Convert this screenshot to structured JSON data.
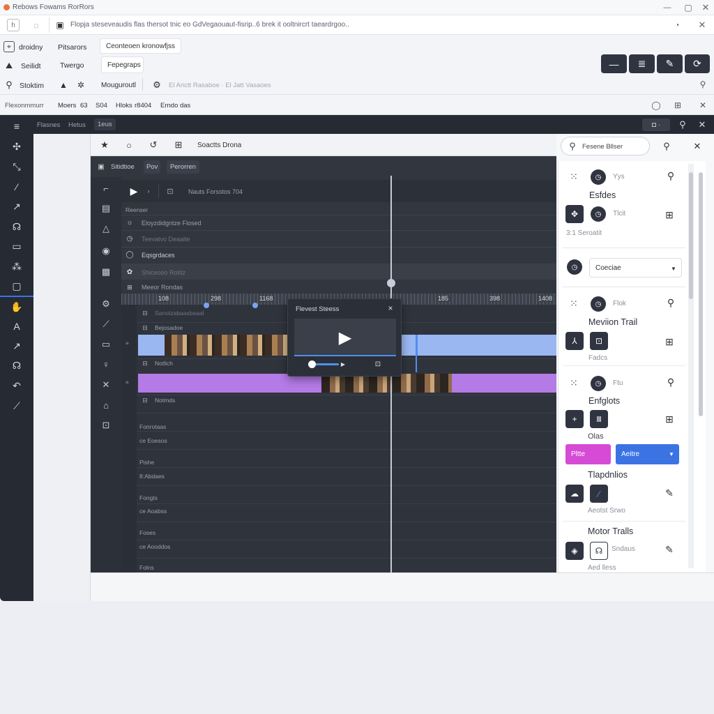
{
  "window": {
    "title": "Rebows Fowams RorRors",
    "address": "Flopja steseveaudis flas thersot tnic eo GdVegaouaut-fisrip..6 brek it ooltnircrt taeardrgoo..."
  },
  "ribbon": {
    "left_items": [
      {
        "icon": "map-pin-icon",
        "label": "droidny"
      },
      {
        "icon": "mountain-icon",
        "label": "Seilidt"
      },
      {
        "icon": "search-icon",
        "label": "Stoktim"
      }
    ],
    "col2": [
      "Pitsarors",
      "Twergo"
    ],
    "pill1": "Ceonteoen kronowfjss",
    "pill2": "Fepegraps",
    "row3_label": "Mouguroutl",
    "row3_hint": "El Arictt Rasaboe  ·  El Jatt Vasaoes",
    "right_buttons": [
      "minus-icon",
      "list-icon",
      "pen-icon",
      "refresh-icon"
    ]
  },
  "statusrow": {
    "label": "Flexonmmurr",
    "items": [
      "Moers",
      "63",
      "S04",
      "Hloks",
      "r8404",
      "Erndo das"
    ]
  },
  "editor": {
    "top_tabs": [
      "Flasnes",
      "Hetus",
      "1eus"
    ],
    "toolbar_title": "Soactts Drona",
    "toolbar2": [
      "Sitidtioe",
      "Pov",
      "Perorren"
    ],
    "track_header": "Nauts Forsstos 704",
    "section_label": "Reenser",
    "layers": [
      {
        "icon": "sun-icon",
        "label": "Eloyzdidgntze Flosed"
      },
      {
        "icon": "clock-icon",
        "label": "Teevatvo Deaalte"
      },
      {
        "icon": "ring-icon",
        "label": "Eqsgrdaces"
      },
      {
        "icon": "palette-icon",
        "label": "Shiceooo Rotitz"
      },
      {
        "icon": "grid-icon",
        "label": "Meeor Rondas"
      }
    ],
    "ruler_marks": [
      "108",
      "298",
      "1168",
      "185",
      "398",
      "1408"
    ],
    "tracks": [
      {
        "label": "Sanotzabaasbaaal"
      },
      {
        "label": "Bejosadoe"
      },
      {
        "label": "Notlich"
      },
      {
        "label": "Notmds"
      }
    ],
    "lower_rows": [
      "Fonrotaas",
      "ce Eoesos",
      "Pishe",
      "8:Abdaes",
      "Fongts",
      "ce Aoabss",
      "Foses",
      "ce Aooddos",
      "Folns"
    ],
    "preview_popup": {
      "title": "Flevest Steess",
      "close": "×"
    }
  },
  "right_panel": {
    "search_placeholder": "Fesene Bllser",
    "sections": [
      {
        "circle_label": "Yys",
        "title": "Esfdes",
        "sub_label": "Tlcit",
        "footer": "3:1 Seroatit"
      },
      {
        "dropdown": "Coeciae"
      },
      {
        "circle_label": "Flok",
        "title": "Meviion Trail",
        "footer": "Fadcs"
      },
      {
        "circle_label": "Ftu",
        "title": "Enfglots",
        "footer": "Olas"
      },
      {
        "pink_button": "Pltte",
        "blue_button": "Aeitre"
      },
      {
        "title": "Tlapdnlios",
        "footer": "Aeotst Srwo"
      },
      {
        "title": "Motor Tralls",
        "sub_label": "Sndaus",
        "footer": "Aed lless"
      }
    ]
  },
  "colors": {
    "accent_blue": "#3b73e3",
    "accent_pink": "#d64bd6",
    "clip_blue": "#9ab7f2",
    "clip_purple": "#b47ae6",
    "playhead": "#c9ccd6",
    "dark_bg": "#262a33"
  }
}
